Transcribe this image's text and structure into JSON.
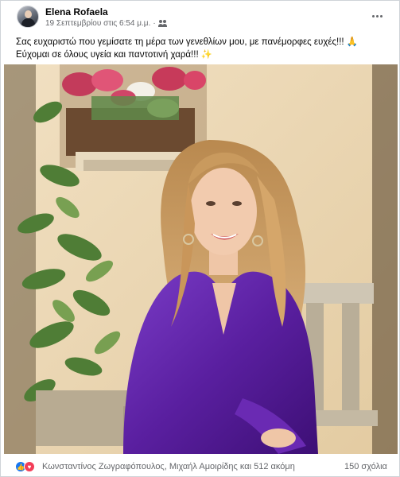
{
  "post": {
    "author": "Elena Rofaela",
    "timestamp": "19 Σεπτεμβρίου στις 6:54 μ.μ.",
    "separator": "·",
    "audience_icon": "friends-icon",
    "more_icon": "more-options-icon",
    "text_line1": "Σας ευχαριστώ που γεμίσατε τη μέρα των γενεθλίων μου, με πανέμορφες ευχές!!!",
    "text_line1_emoji": "🙏",
    "text_line2": "Εύχομαι σε όλους υγεία και παντοτινή χαρά!!!",
    "text_line2_emoji": "✨"
  },
  "footer": {
    "reaction_icons": [
      "like-icon",
      "love-icon"
    ],
    "reactors": "Κωνσταντίνος Ζωγραφόπουλος, Μιχαήλ Αμοιρίδης και 512 ακόμη",
    "comments": "150 σχόλια"
  },
  "colors": {
    "link_blue": "#1877f2",
    "love_red": "#f33e58",
    "secondary_text": "#65676b",
    "dress_purple": "#5a1fa0"
  }
}
